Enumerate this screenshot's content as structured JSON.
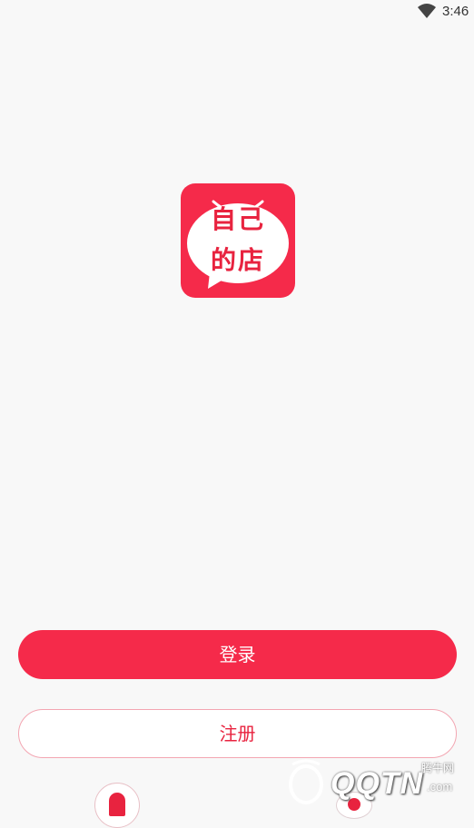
{
  "status_bar": {
    "time": "3:46",
    "wifi_icon": "wifi-icon"
  },
  "app_logo": {
    "line1": "自己",
    "line2": "的店",
    "color": "#f52a4a"
  },
  "login_button": {
    "label": "登录"
  },
  "register_button": {
    "label": "注册"
  },
  "watermark": {
    "logo_text": "QQTN",
    "site_name": "腾牛网",
    "domain": ".com"
  },
  "colors": {
    "accent": "#f52a4a",
    "background": "#f8f8f8",
    "text_accent": "#e8233f"
  }
}
